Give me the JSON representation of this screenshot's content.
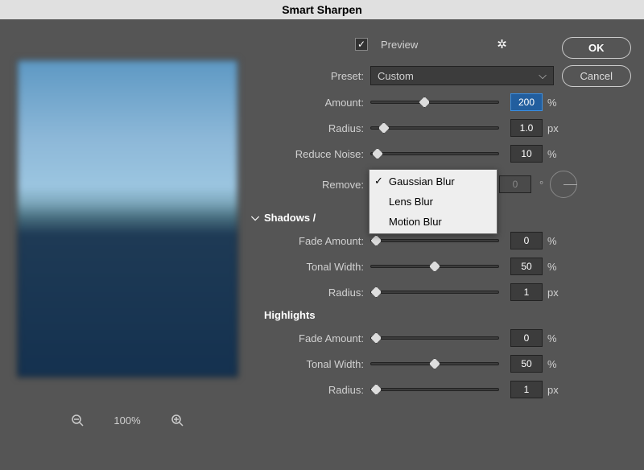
{
  "title": "Smart Sharpen",
  "preview_label": "Preview",
  "preview_checked": true,
  "buttons": {
    "ok": "OK",
    "cancel": "Cancel"
  },
  "preset_label": "Preset:",
  "preset_value": "Custom",
  "sliders": {
    "amount": {
      "label": "Amount:",
      "value": "200",
      "unit": "%",
      "pos": 42,
      "highlighted": true
    },
    "radius": {
      "label": "Radius:",
      "value": "1.0",
      "unit": "px",
      "pos": 10
    },
    "reduce_noise": {
      "label": "Reduce Noise:",
      "value": "10",
      "unit": "%",
      "pos": 5
    }
  },
  "remove": {
    "label": "Remove:",
    "options": [
      "Gaussian Blur",
      "Lens Blur",
      "Motion Blur"
    ],
    "selected": "Gaussian Blur",
    "angle_value": "0"
  },
  "shadows_header": "Shadows /",
  "highlights_header": "Highlights",
  "shadows": {
    "fade": {
      "label": "Fade Amount:",
      "value": "0",
      "unit": "%",
      "pos": 4
    },
    "tonal": {
      "label": "Tonal Width:",
      "value": "50",
      "unit": "%",
      "pos": 50
    },
    "radius": {
      "label": "Radius:",
      "value": "1",
      "unit": "px",
      "pos": 4
    }
  },
  "highlights": {
    "fade": {
      "label": "Fade Amount:",
      "value": "0",
      "unit": "%",
      "pos": 4
    },
    "tonal": {
      "label": "Tonal Width:",
      "value": "50",
      "unit": "%",
      "pos": 50
    },
    "radius": {
      "label": "Radius:",
      "value": "1",
      "unit": "px",
      "pos": 4
    }
  },
  "zoom": {
    "level": "100%"
  }
}
